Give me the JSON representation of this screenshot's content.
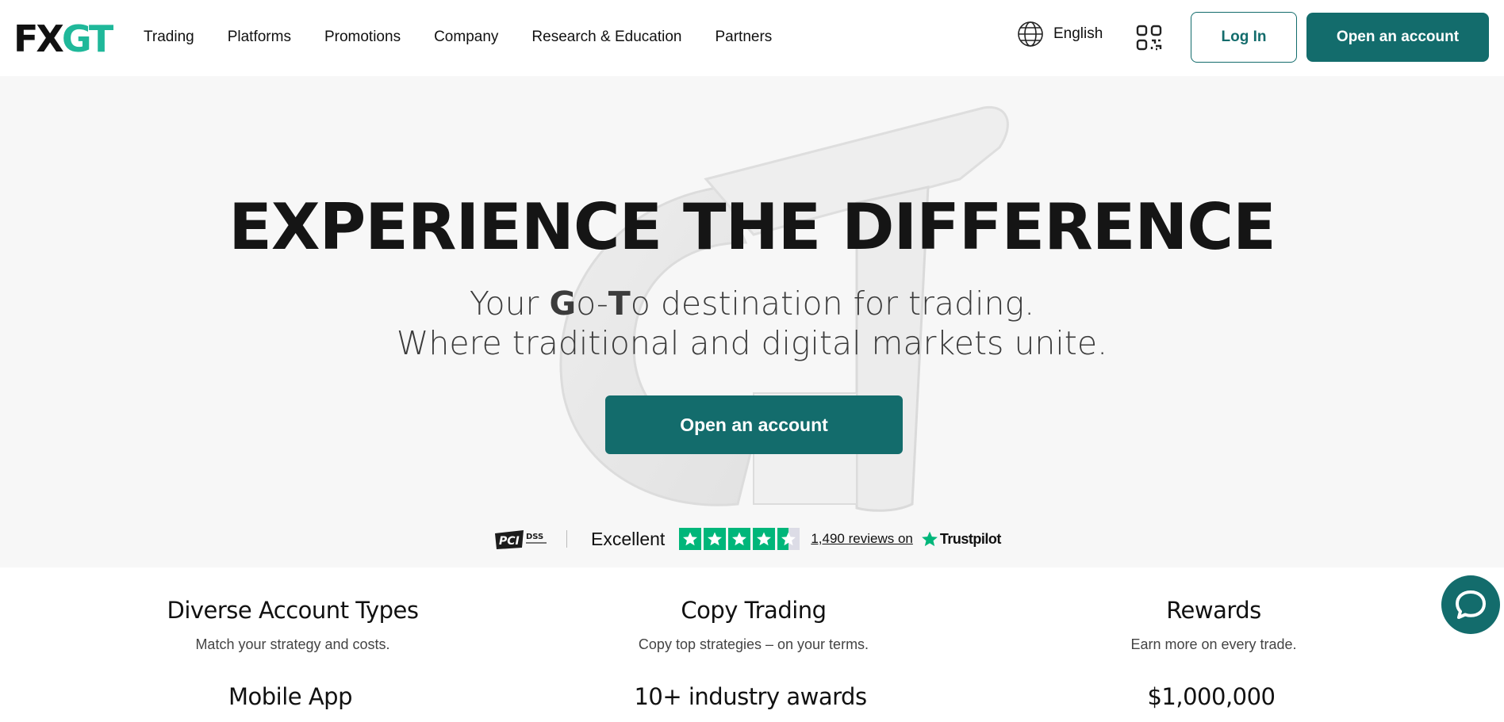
{
  "header": {
    "logo": {
      "fx": "FX",
      "gt": "GT"
    },
    "nav": [
      {
        "label": "Trading"
      },
      {
        "label": "Platforms"
      },
      {
        "label": "Promotions"
      },
      {
        "label": "Company"
      },
      {
        "label": "Research & Education"
      },
      {
        "label": "Partners"
      }
    ],
    "language": "English",
    "login_label": "Log In",
    "open_account_label": "Open an account"
  },
  "hero": {
    "title": "EXPERIENCE THE DIFFERENCE",
    "subtitle_line1": {
      "pre": "Your ",
      "g": "G",
      "mid": "o-",
      "t": "T",
      "post": "o destination for trading."
    },
    "subtitle_line2": "Where traditional and digital markets unite.",
    "cta_label": "Open an account",
    "trust": {
      "pci_label": "PCI DSS",
      "rating_text": "Excellent",
      "star_rating": 4.5,
      "reviews_text": "1,490 reviews on",
      "trustpilot": "Trustpilot"
    }
  },
  "features": [
    {
      "title": "Diverse Account Types",
      "desc": "Match your strategy and costs."
    },
    {
      "title": "Copy Trading",
      "desc": "Copy top strategies – on your terms."
    },
    {
      "title": "Rewards",
      "desc": "Earn more on every trade."
    }
  ],
  "stats": [
    {
      "value": "Mobile App"
    },
    {
      "value": "10+ industry awards"
    },
    {
      "value": "$1,000,000"
    }
  ],
  "colors": {
    "brand": "#136c6c",
    "logo_accent": "#1fb89a",
    "trustpilot_green": "#00b67a"
  },
  "icons": {
    "language": "globe-icon",
    "qr": "qr-code-icon",
    "chat": "chat-icon"
  }
}
